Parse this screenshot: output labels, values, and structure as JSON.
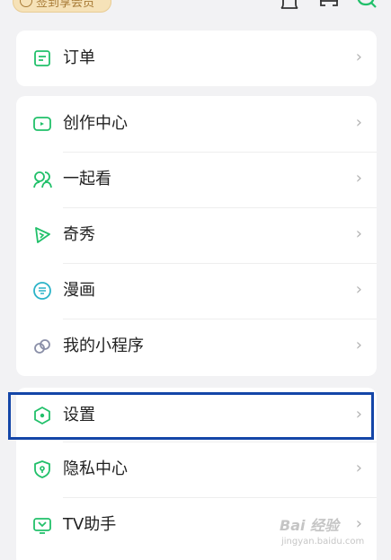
{
  "header": {
    "vip_badge": "签到享会员",
    "icons": [
      "bell-icon",
      "scan-icon",
      "search-icon"
    ]
  },
  "menu": {
    "order": {
      "label": "订单",
      "icon": "order-icon"
    },
    "main": [
      {
        "label": "创作中心",
        "icon": "creation-center-icon"
      },
      {
        "label": "一起看",
        "icon": "watch-together-icon"
      },
      {
        "label": "奇秀",
        "icon": "qixiu-icon"
      },
      {
        "label": "漫画",
        "icon": "comic-icon"
      },
      {
        "label": "我的小程序",
        "icon": "mini-program-icon"
      }
    ],
    "settings": [
      {
        "label": "设置",
        "icon": "settings-icon"
      },
      {
        "label": "隐私中心",
        "icon": "privacy-shield-icon"
      },
      {
        "label": "TV助手",
        "icon": "tv-icon"
      }
    ]
  },
  "chevron": "›",
  "watermark": {
    "main": "Bai 经验",
    "sub": "jingyan.baidu.com"
  },
  "colors": {
    "icon_green": "#21c06a",
    "highlight_border": "#1446a8",
    "chevron": "#b3b3b3"
  }
}
